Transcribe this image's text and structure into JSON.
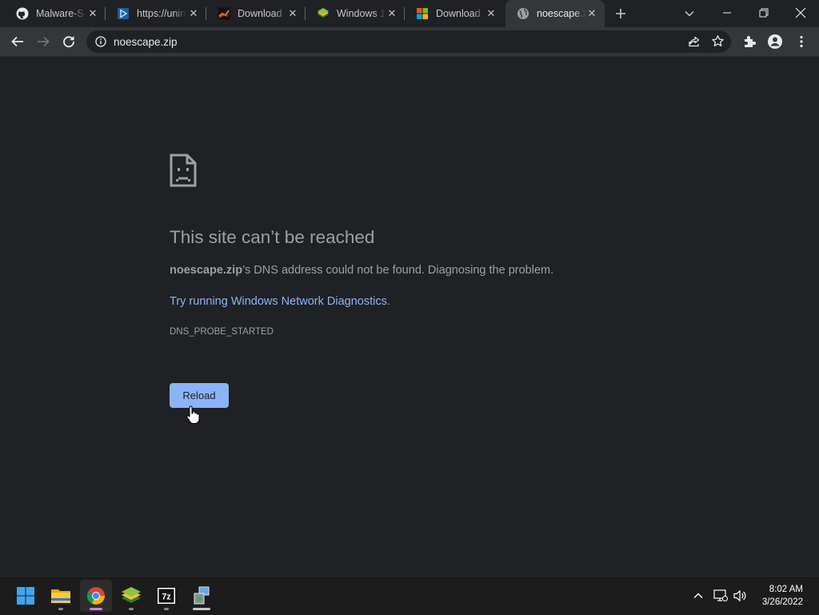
{
  "tabs": [
    {
      "title": "Malware-Sa",
      "favicon": "github-icon"
    },
    {
      "title": "https://unin",
      "favicon": "play-icon"
    },
    {
      "title": "Download",
      "favicon": "download-site-icon"
    },
    {
      "title": "Windows 1",
      "favicon": "bluestacks-icon"
    },
    {
      "title": "Download",
      "favicon": "microsoft-icon"
    },
    {
      "title": "noescape.z",
      "favicon": "globe-icon",
      "active": true
    }
  ],
  "address_bar": {
    "url": "noescape.zip"
  },
  "error_page": {
    "heading": "This site can’t be reached",
    "description_host": "noescape.zip",
    "description_rest": "’s DNS address could not be found. Diagnosing the problem.",
    "suggestion_link": "Try running Windows Network Diagnostics",
    "suggestion_end": ".",
    "error_code": "DNS_PROBE_STARTED",
    "reload_label": "Reload"
  },
  "taskbar": {
    "apps": [
      "start-icon",
      "file-explorer-icon",
      "chrome-icon",
      "bluestacks-icon",
      "7zip-icon",
      "network-installer-icon"
    ],
    "time": "8:02 AM",
    "date": "3/26/2022"
  },
  "colors": {
    "background": "#202124",
    "toolbar": "#35363a",
    "link": "#8ab4f8",
    "button": "#8ab4f8",
    "text": "#9aa0a6"
  }
}
